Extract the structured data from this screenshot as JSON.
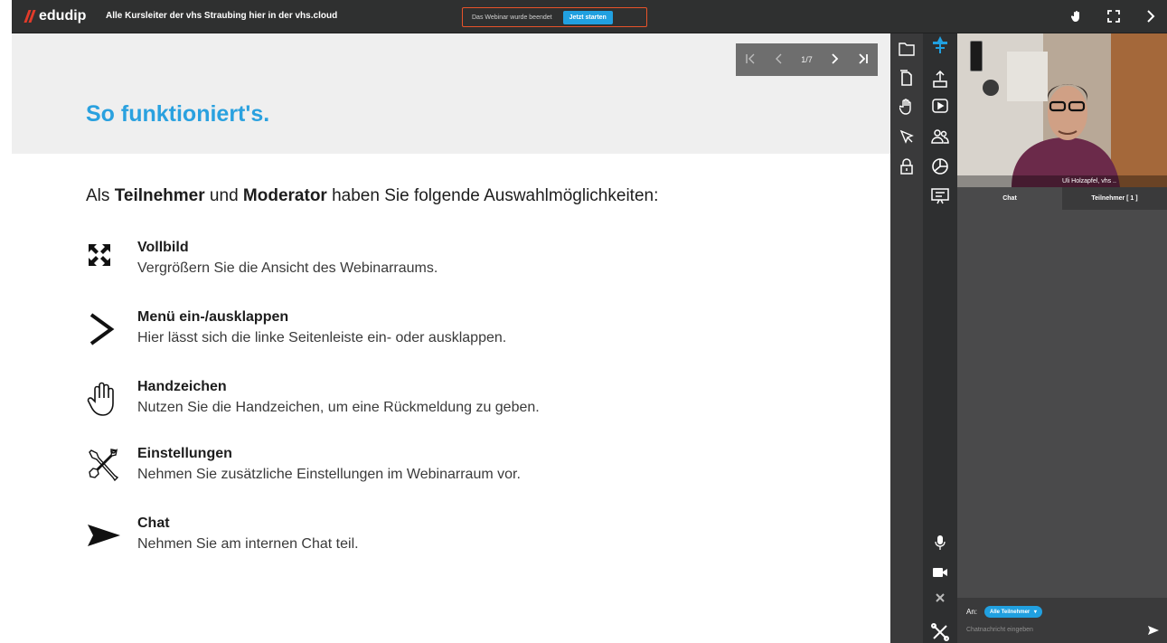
{
  "app": {
    "brand": "edudip",
    "course_title": "Alle Kursleiter der vhs Straubing hier in der vhs.cloud",
    "status_text": "Das Webinar wurde beendet",
    "start_button": "Jetzt starten",
    "accent": "#21a0e0",
    "brand_red": "#e23b2a"
  },
  "slide": {
    "pager_text": "1/7",
    "title": "So funktioniert's.",
    "intro_prefix": "Als ",
    "intro_bold1": "Teilnehmer",
    "intro_mid": " und ",
    "intro_bold2": "Moderator",
    "intro_suffix": " haben Sie folgende Auswahlmöglichkeiten:",
    "features": [
      {
        "title": "Vollbild",
        "desc": "Vergrößern Sie die Ansicht des Webinarraums.",
        "icon": "fullscreen-icon"
      },
      {
        "title": "Menü ein-/ausklappen",
        "desc": "Hier lässt sich die linke Seitenleiste ein- oder ausklappen.",
        "icon": "chevron-right-icon"
      },
      {
        "title": "Handzeichen",
        "desc": "Nutzen Sie die Handzeichen, um eine Rückmeldung zu geben.",
        "icon": "hand-icon"
      },
      {
        "title": "Einstellungen",
        "desc": "Nehmen Sie zusätzliche Einstellungen im Webinarraum vor.",
        "icon": "tools-icon"
      },
      {
        "title": "Chat",
        "desc": "Nehmen Sie am internen Chat teil.",
        "icon": "send-icon"
      }
    ]
  },
  "video": {
    "participant_name": "Uli Holzapfel, vhs .."
  },
  "tabs": {
    "chat": "Chat",
    "participants": "Teilnehmer [ 1 ]"
  },
  "chat": {
    "recipient_label": "An:",
    "recipient_value": "Alle Teilnehmer",
    "input_placeholder": "Chatnachricht eingeben"
  }
}
